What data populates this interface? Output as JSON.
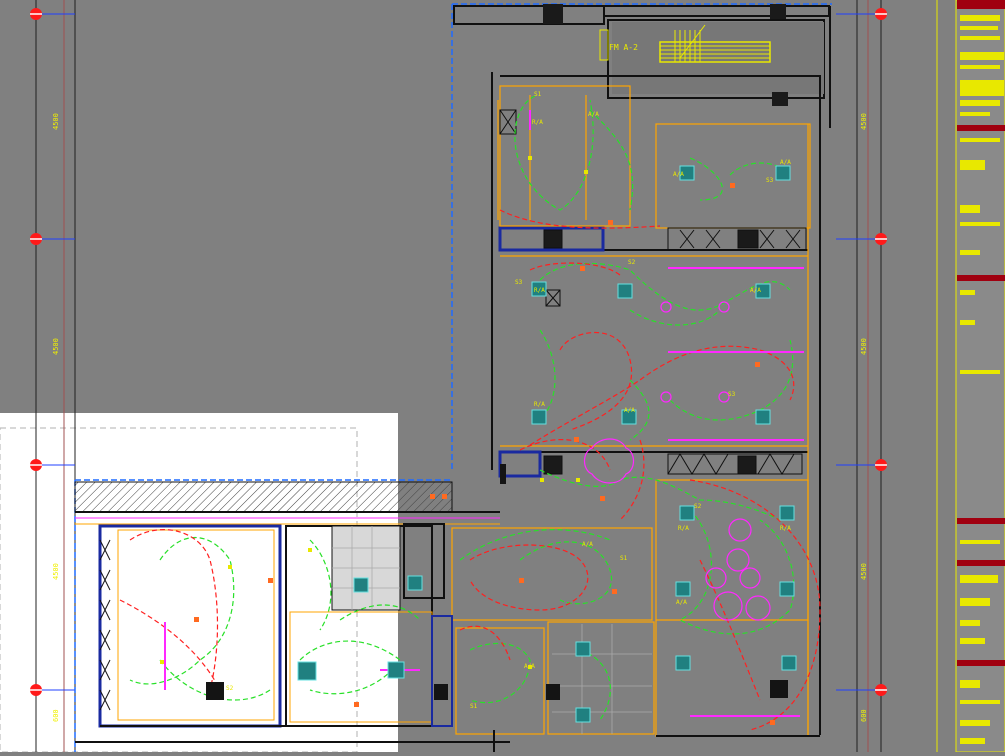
{
  "drawing": {
    "labels": {
      "stair_code": "FM A-2",
      "fixture_aa": "A/A",
      "fixture_ra": "R/A",
      "switch_s1": "S1",
      "switch_s2": "S2",
      "switch_s3": "S3"
    },
    "colors": {
      "background": "#808080",
      "wall": "#0a0a0a",
      "dim_line": "#1a1a1a",
      "dim_text": "#f0f000",
      "axis_bubble": "#ff1a1a",
      "partition": "#ffa500",
      "boundary_blue": "#1f6bff",
      "circuit_green": "#28e028",
      "circuit_red": "#ff2020",
      "magenta": "#ff28ff",
      "teal": "#20a0a0",
      "white_area": "#ffffff",
      "legend_red": "#a00010",
      "legend_yellow": "#e8e800"
    }
  }
}
